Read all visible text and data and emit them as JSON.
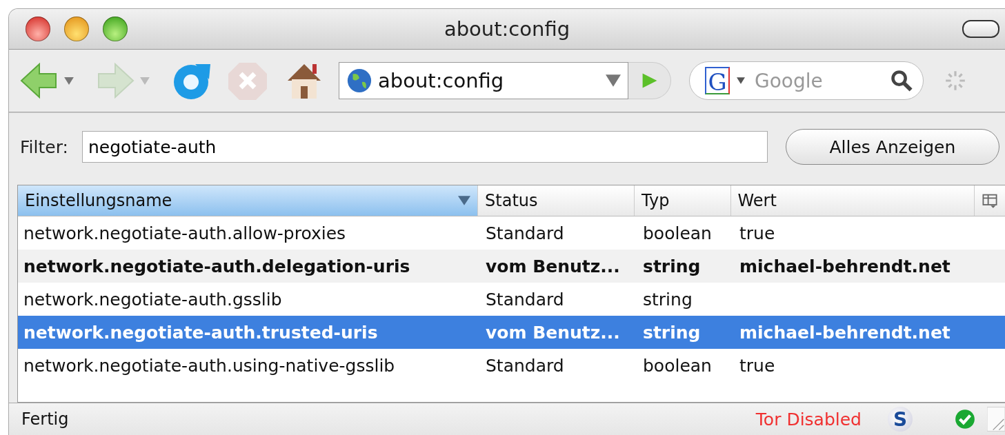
{
  "window": {
    "title": "about:config"
  },
  "toolbar": {
    "address": "about:config",
    "search": {
      "engine_letter": "G",
      "placeholder": "Google"
    }
  },
  "filter": {
    "label": "Filter:",
    "value": "negotiate-auth",
    "button": "Alles Anzeigen"
  },
  "table": {
    "columns": [
      {
        "label": "Einstellungsname",
        "sorted": true
      },
      {
        "label": "Status",
        "sorted": false
      },
      {
        "label": "Typ",
        "sorted": false
      },
      {
        "label": "Wert",
        "sorted": false
      }
    ],
    "rows": [
      {
        "name": "network.negotiate-auth.allow-proxies",
        "status": "Standard",
        "type": "boolean",
        "value": "true",
        "modified": false,
        "selected": false
      },
      {
        "name": "network.negotiate-auth.delegation-uris",
        "status": "vom Benutz...",
        "type": "string",
        "value": "michael-behrendt.net",
        "modified": true,
        "selected": false
      },
      {
        "name": "network.negotiate-auth.gsslib",
        "status": "Standard",
        "type": "string",
        "value": "",
        "modified": false,
        "selected": false
      },
      {
        "name": "network.negotiate-auth.trusted-uris",
        "status": "vom Benutz...",
        "type": "string",
        "value": "michael-behrendt.net",
        "modified": true,
        "selected": true
      },
      {
        "name": "network.negotiate-auth.using-native-gsslib",
        "status": "Standard",
        "type": "boolean",
        "value": "true",
        "modified": false,
        "selected": false
      }
    ]
  },
  "status_bar": {
    "text": "Fertig",
    "tor": "Tor Disabled",
    "addon_letter": "S"
  }
}
